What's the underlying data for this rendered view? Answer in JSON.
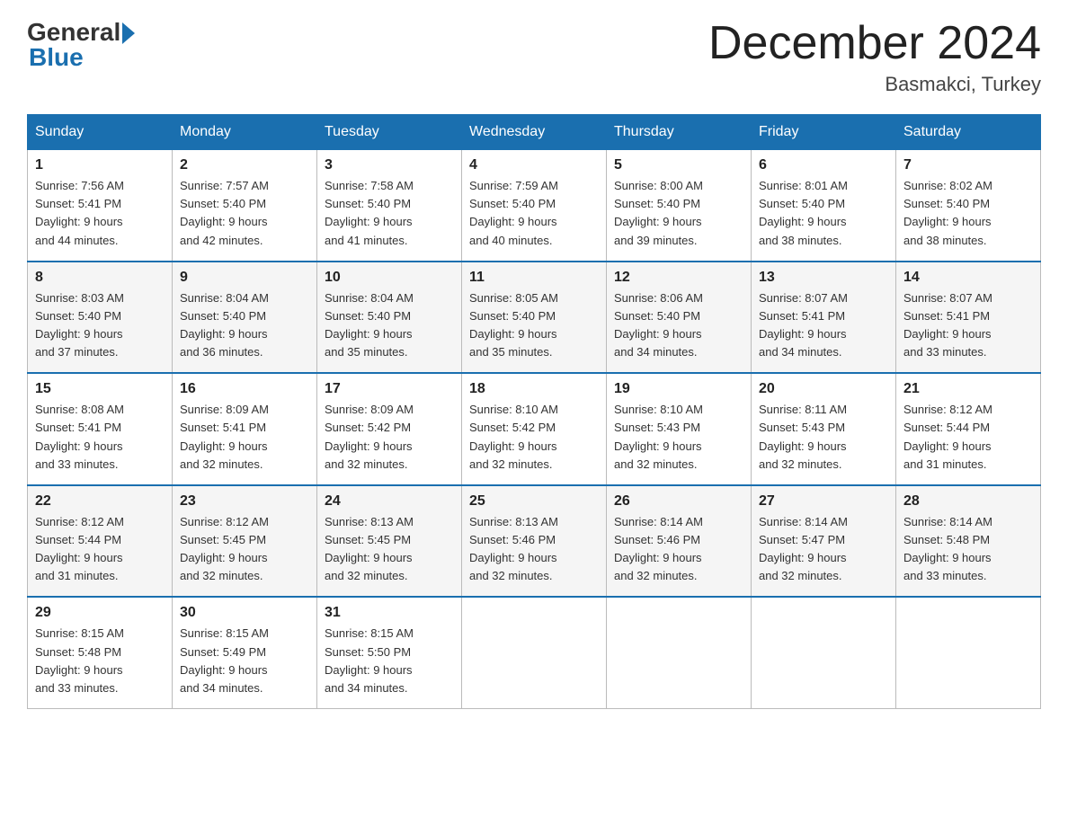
{
  "logo": {
    "general": "General",
    "blue": "Blue"
  },
  "header": {
    "month": "December 2024",
    "location": "Basmakci, Turkey"
  },
  "days_of_week": [
    "Sunday",
    "Monday",
    "Tuesday",
    "Wednesday",
    "Thursday",
    "Friday",
    "Saturday"
  ],
  "weeks": [
    [
      {
        "day": "1",
        "sunrise": "7:56 AM",
        "sunset": "5:41 PM",
        "daylight": "9 hours and 44 minutes."
      },
      {
        "day": "2",
        "sunrise": "7:57 AM",
        "sunset": "5:40 PM",
        "daylight": "9 hours and 42 minutes."
      },
      {
        "day": "3",
        "sunrise": "7:58 AM",
        "sunset": "5:40 PM",
        "daylight": "9 hours and 41 minutes."
      },
      {
        "day": "4",
        "sunrise": "7:59 AM",
        "sunset": "5:40 PM",
        "daylight": "9 hours and 40 minutes."
      },
      {
        "day": "5",
        "sunrise": "8:00 AM",
        "sunset": "5:40 PM",
        "daylight": "9 hours and 39 minutes."
      },
      {
        "day": "6",
        "sunrise": "8:01 AM",
        "sunset": "5:40 PM",
        "daylight": "9 hours and 38 minutes."
      },
      {
        "day": "7",
        "sunrise": "8:02 AM",
        "sunset": "5:40 PM",
        "daylight": "9 hours and 38 minutes."
      }
    ],
    [
      {
        "day": "8",
        "sunrise": "8:03 AM",
        "sunset": "5:40 PM",
        "daylight": "9 hours and 37 minutes."
      },
      {
        "day": "9",
        "sunrise": "8:04 AM",
        "sunset": "5:40 PM",
        "daylight": "9 hours and 36 minutes."
      },
      {
        "day": "10",
        "sunrise": "8:04 AM",
        "sunset": "5:40 PM",
        "daylight": "9 hours and 35 minutes."
      },
      {
        "day": "11",
        "sunrise": "8:05 AM",
        "sunset": "5:40 PM",
        "daylight": "9 hours and 35 minutes."
      },
      {
        "day": "12",
        "sunrise": "8:06 AM",
        "sunset": "5:40 PM",
        "daylight": "9 hours and 34 minutes."
      },
      {
        "day": "13",
        "sunrise": "8:07 AM",
        "sunset": "5:41 PM",
        "daylight": "9 hours and 34 minutes."
      },
      {
        "day": "14",
        "sunrise": "8:07 AM",
        "sunset": "5:41 PM",
        "daylight": "9 hours and 33 minutes."
      }
    ],
    [
      {
        "day": "15",
        "sunrise": "8:08 AM",
        "sunset": "5:41 PM",
        "daylight": "9 hours and 33 minutes."
      },
      {
        "day": "16",
        "sunrise": "8:09 AM",
        "sunset": "5:41 PM",
        "daylight": "9 hours and 32 minutes."
      },
      {
        "day": "17",
        "sunrise": "8:09 AM",
        "sunset": "5:42 PM",
        "daylight": "9 hours and 32 minutes."
      },
      {
        "day": "18",
        "sunrise": "8:10 AM",
        "sunset": "5:42 PM",
        "daylight": "9 hours and 32 minutes."
      },
      {
        "day": "19",
        "sunrise": "8:10 AM",
        "sunset": "5:43 PM",
        "daylight": "9 hours and 32 minutes."
      },
      {
        "day": "20",
        "sunrise": "8:11 AM",
        "sunset": "5:43 PM",
        "daylight": "9 hours and 32 minutes."
      },
      {
        "day": "21",
        "sunrise": "8:12 AM",
        "sunset": "5:44 PM",
        "daylight": "9 hours and 31 minutes."
      }
    ],
    [
      {
        "day": "22",
        "sunrise": "8:12 AM",
        "sunset": "5:44 PM",
        "daylight": "9 hours and 31 minutes."
      },
      {
        "day": "23",
        "sunrise": "8:12 AM",
        "sunset": "5:45 PM",
        "daylight": "9 hours and 32 minutes."
      },
      {
        "day": "24",
        "sunrise": "8:13 AM",
        "sunset": "5:45 PM",
        "daylight": "9 hours and 32 minutes."
      },
      {
        "day": "25",
        "sunrise": "8:13 AM",
        "sunset": "5:46 PM",
        "daylight": "9 hours and 32 minutes."
      },
      {
        "day": "26",
        "sunrise": "8:14 AM",
        "sunset": "5:46 PM",
        "daylight": "9 hours and 32 minutes."
      },
      {
        "day": "27",
        "sunrise": "8:14 AM",
        "sunset": "5:47 PM",
        "daylight": "9 hours and 32 minutes."
      },
      {
        "day": "28",
        "sunrise": "8:14 AM",
        "sunset": "5:48 PM",
        "daylight": "9 hours and 33 minutes."
      }
    ],
    [
      {
        "day": "29",
        "sunrise": "8:15 AM",
        "sunset": "5:48 PM",
        "daylight": "9 hours and 33 minutes."
      },
      {
        "day": "30",
        "sunrise": "8:15 AM",
        "sunset": "5:49 PM",
        "daylight": "9 hours and 34 minutes."
      },
      {
        "day": "31",
        "sunrise": "8:15 AM",
        "sunset": "5:50 PM",
        "daylight": "9 hours and 34 minutes."
      },
      null,
      null,
      null,
      null
    ]
  ],
  "labels": {
    "sunrise": "Sunrise:",
    "sunset": "Sunset:",
    "daylight": "Daylight:"
  }
}
